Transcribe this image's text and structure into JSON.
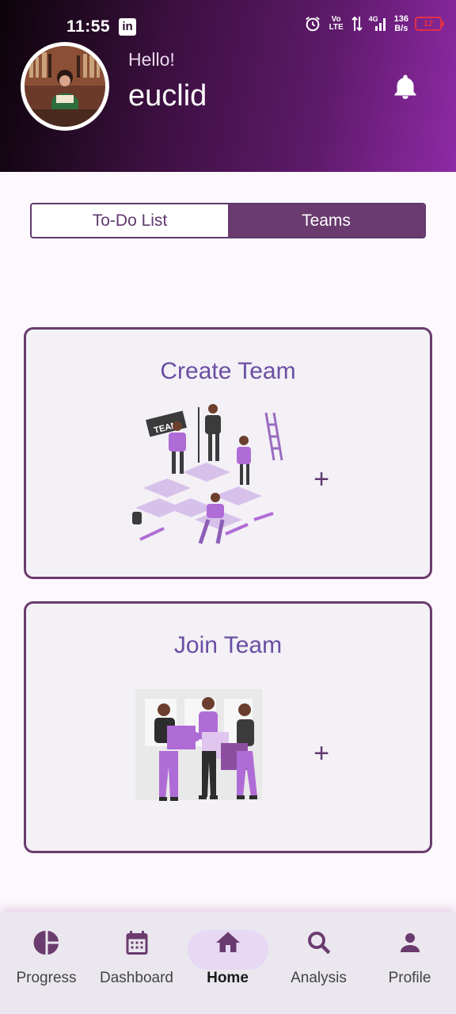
{
  "status_bar": {
    "time": "11:55",
    "app_badge": "in",
    "volte": "Vo LTE",
    "network": "4G",
    "speed_value": "136",
    "speed_unit": "B/s",
    "battery": "12"
  },
  "header": {
    "greeting": "Hello!",
    "username": "euclid"
  },
  "tabs": [
    {
      "label": "To-Do List",
      "selected": false
    },
    {
      "label": "Teams",
      "selected": true
    }
  ],
  "cards": [
    {
      "title": "Create Team",
      "plus": "+",
      "illustration": "team-building-illustration"
    },
    {
      "title": "Join Team",
      "plus": "+",
      "illustration": "puzzle-join-illustration"
    }
  ],
  "nav": [
    {
      "label": "Progress",
      "icon": "pie-chart-icon",
      "active": false
    },
    {
      "label": "Dashboard",
      "icon": "calendar-icon",
      "active": false
    },
    {
      "label": "Home",
      "icon": "home-icon",
      "active": true
    },
    {
      "label": "Analysis",
      "icon": "search-icon",
      "active": false
    },
    {
      "label": "Profile",
      "icon": "person-icon",
      "active": false
    }
  ],
  "colors": {
    "accent": "#6a3b6e",
    "title": "#6a4ea3",
    "header_start": "#0c0409",
    "header_end": "#8e2aa6",
    "pill": "#e7d8f3"
  }
}
